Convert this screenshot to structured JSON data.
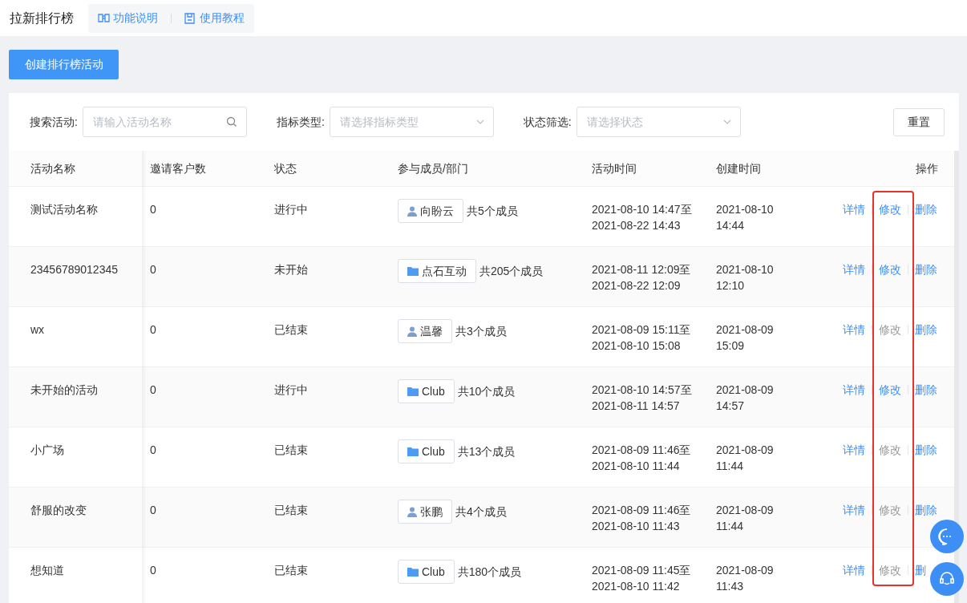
{
  "header": {
    "title": "拉新排行榜",
    "links": [
      "功能说明",
      "使用教程"
    ]
  },
  "create_button": "创建排行榜活动",
  "filters": [
    {
      "label": "搜索活动:",
      "placeholder": "请输入活动名称",
      "kind": "search"
    },
    {
      "label": "指标类型:",
      "placeholder": "请选择指标类型",
      "kind": "select"
    },
    {
      "label": "状态筛选:",
      "placeholder": "请选择状态",
      "kind": "select"
    }
  ],
  "reset_button": "重置",
  "table": {
    "columns": [
      "活动名称",
      "邀请客户数",
      "状态",
      "参与成员/部门",
      "活动时间",
      "创建时间",
      "操作"
    ],
    "rows": [
      {
        "name": "测试活动名称",
        "invites": "0",
        "status": "进行中",
        "member": {
          "kind": "person",
          "label": "向盼云"
        },
        "member_count": "共5个成员",
        "time": [
          "2021-08-10 14:47至",
          "2021-08-22 14:43"
        ],
        "created": [
          "2021-08-10",
          "14:44"
        ],
        "actions": [
          {
            "label": "详情",
            "disabled": false
          },
          {
            "label": "修改",
            "disabled": false
          },
          {
            "label": "删除",
            "disabled": false
          }
        ]
      },
      {
        "name": "23456789012345",
        "invites": "0",
        "status": "未开始",
        "member": {
          "kind": "department",
          "label": "点石互动"
        },
        "member_count": "共205个成员",
        "time": [
          "2021-08-11 12:09至",
          "2021-08-22 12:09"
        ],
        "created": [
          "2021-08-10",
          "12:10"
        ],
        "actions": [
          {
            "label": "详情",
            "disabled": false
          },
          {
            "label": "修改",
            "disabled": false
          },
          {
            "label": "删除",
            "disabled": false
          }
        ]
      },
      {
        "name": "wx",
        "invites": "0",
        "status": "已结束",
        "member": {
          "kind": "person",
          "label": "温馨"
        },
        "member_count": "共3个成员",
        "time": [
          "2021-08-09 15:11至",
          "2021-08-10 15:08"
        ],
        "created": [
          "2021-08-09",
          "15:09"
        ],
        "actions": [
          {
            "label": "详情",
            "disabled": false
          },
          {
            "label": "修改",
            "disabled": true
          },
          {
            "label": "删除",
            "disabled": false
          }
        ]
      },
      {
        "name": "未开始的活动",
        "invites": "0",
        "status": "进行中",
        "member": {
          "kind": "department",
          "label": "Club"
        },
        "member_count": "共10个成员",
        "time": [
          "2021-08-10 14:57至",
          "2021-08-11 14:57"
        ],
        "created": [
          "2021-08-09",
          "14:57"
        ],
        "actions": [
          {
            "label": "详情",
            "disabled": false
          },
          {
            "label": "修改",
            "disabled": false
          },
          {
            "label": "删除",
            "disabled": false
          }
        ]
      },
      {
        "name": "小广场",
        "invites": "0",
        "status": "已结束",
        "member": {
          "kind": "department",
          "label": "Club"
        },
        "member_count": "共13个成员",
        "time": [
          "2021-08-09 11:46至",
          "2021-08-10 11:44"
        ],
        "created": [
          "2021-08-09",
          "11:44"
        ],
        "actions": [
          {
            "label": "详情",
            "disabled": false
          },
          {
            "label": "修改",
            "disabled": true
          },
          {
            "label": "删除",
            "disabled": false
          }
        ]
      },
      {
        "name": "舒服的改变",
        "invites": "0",
        "status": "已结束",
        "member": {
          "kind": "person",
          "label": "张鹏"
        },
        "member_count": "共4个成员",
        "time": [
          "2021-08-09 11:46至",
          "2021-08-10 11:43"
        ],
        "created": [
          "2021-08-09",
          "11:44"
        ],
        "actions": [
          {
            "label": "详情",
            "disabled": false
          },
          {
            "label": "修改",
            "disabled": true
          },
          {
            "label": "删除",
            "disabled": false
          }
        ]
      },
      {
        "name": "想知道",
        "invites": "0",
        "status": "已结束",
        "member": {
          "kind": "department",
          "label": "Club"
        },
        "member_count": "共180个成员",
        "time": [
          "2021-08-09 11:45至",
          "2021-08-10 11:42"
        ],
        "created": [
          "2021-08-09",
          "11:43"
        ],
        "actions": [
          {
            "label": "详情",
            "disabled": false
          },
          {
            "label": "修改",
            "disabled": true
          },
          {
            "label": "删",
            "disabled": false
          }
        ]
      }
    ]
  }
}
